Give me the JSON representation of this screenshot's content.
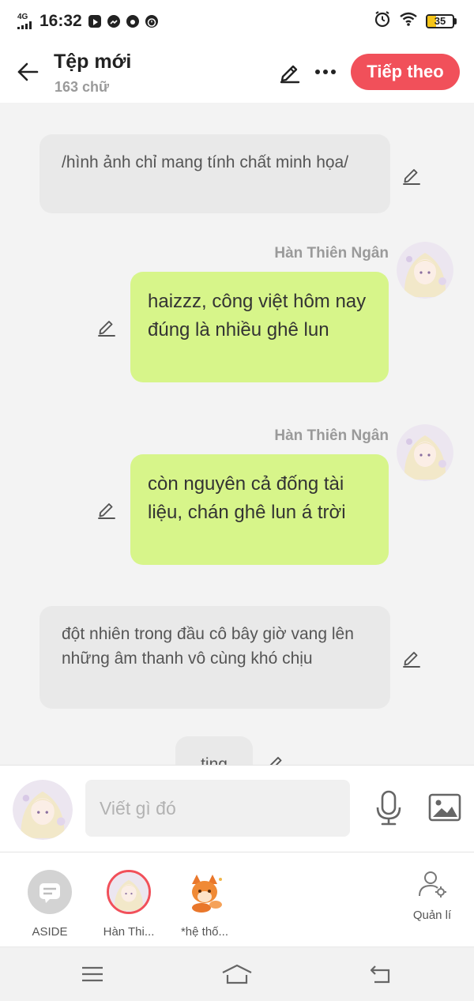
{
  "status_bar": {
    "network": "4G",
    "time": "16:32",
    "battery": "35",
    "battery_fraction": 0.35
  },
  "header": {
    "title": "Tệp mới",
    "subtitle": "163 chữ",
    "next_label": "Tiếp theo"
  },
  "messages": [
    {
      "type": "narration",
      "text": "/hình ảnh chỉ mang tính chất minh họa/"
    },
    {
      "type": "dialogue",
      "speaker": "Hàn Thiên Ngân",
      "text": "haizzz, công việt hôm nay đúng là nhiều ghê lun"
    },
    {
      "type": "dialogue",
      "speaker": "Hàn Thiên Ngân",
      "text": "còn nguyên cả đống tài liệu, chán ghê lun á trời"
    },
    {
      "type": "narration",
      "text": "đột nhiên trong đầu cô bây giờ vang lên những âm thanh vô cùng khó chịu"
    },
    {
      "type": "narration",
      "text": "ting"
    }
  ],
  "input": {
    "placeholder": "Viết gì đó"
  },
  "characters": [
    {
      "label": "ASIDE",
      "icon": "speech-bubble-icon"
    },
    {
      "label": "Hàn Thi...",
      "icon": "character-avatar"
    },
    {
      "label": "*hệ thố...",
      "icon": "fox-mascot-avatar"
    }
  ],
  "manage_label": "Quản lí",
  "colors": {
    "accent": "#f1505a",
    "bubble": "#d7f58a",
    "narration_bg": "#e9e9e9",
    "selected_ring": "#f1505a"
  }
}
